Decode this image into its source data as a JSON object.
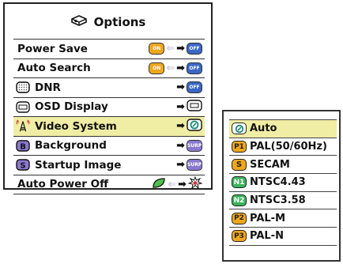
{
  "options_menu": {
    "title": "Options",
    "title_icon": "projector-icon",
    "items": [
      {
        "label": "Power Save",
        "state_from": "ON",
        "state_to": "OFF"
      },
      {
        "label": "Auto Search",
        "state_from": "ON",
        "state_to": "OFF"
      },
      {
        "label": "DNR",
        "icon": "dnr-icon",
        "state_to": "OFF"
      },
      {
        "label": "OSD Display",
        "icon": "osd-display-icon"
      },
      {
        "label": "Video System",
        "icon": "video-system-icon",
        "selected": true
      },
      {
        "label": "Background",
        "icon": "background-b-icon",
        "state_to": "SURP"
      },
      {
        "label": "Startup Image",
        "icon": "startup-s-icon",
        "state_to": "SURP"
      },
      {
        "label": "Auto Power Off",
        "icon_from": "leaf-icon",
        "icon_to": "power-off-burst-icon"
      }
    ]
  },
  "video_system_menu": {
    "items": [
      {
        "badge": "",
        "label": "Auto",
        "icon": "auto-icon",
        "selected": true
      },
      {
        "badge": "P1",
        "label": "PAL(50/60Hz)"
      },
      {
        "badge": "S",
        "label": "SECAM"
      },
      {
        "badge": "N1",
        "label": "NTSC4.43"
      },
      {
        "badge": "N2",
        "label": "NTSC3.58"
      },
      {
        "badge": "P2",
        "label": "PAL-M"
      },
      {
        "badge": "P3",
        "label": "PAL-N"
      }
    ]
  },
  "colors": {
    "selection_highlight": "#f0eda4",
    "on_pill": "#f0a71d",
    "off_pill": "#3a67c4",
    "ntsc_badge": "#3cb35c"
  }
}
